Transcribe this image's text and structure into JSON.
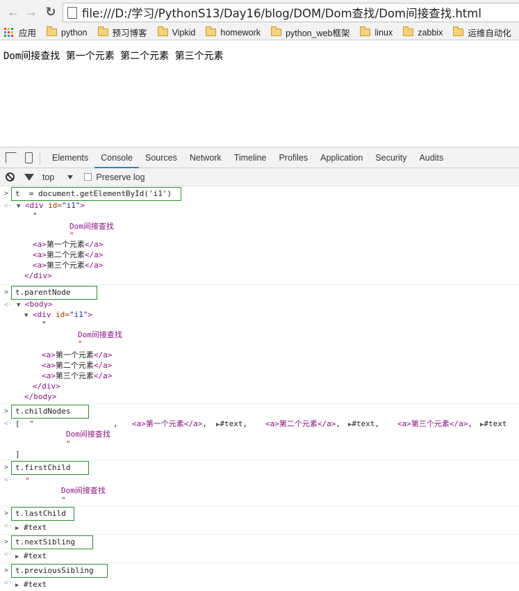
{
  "browser": {
    "url": "file:///D:/学习/PythonS13/Day16/blog/DOM/Dom查找/Dom间接查找.html",
    "bookmarks": [
      {
        "label": "应用",
        "icon": "apps-grid-icon"
      },
      {
        "label": "python",
        "icon": "folder-icon"
      },
      {
        "label": "预习博客",
        "icon": "folder-icon"
      },
      {
        "label": "Vipkid",
        "icon": "folder-icon"
      },
      {
        "label": "homework",
        "icon": "folder-icon"
      },
      {
        "label": "python_web框架",
        "icon": "folder-icon"
      },
      {
        "label": "linux",
        "icon": "folder-icon"
      },
      {
        "label": "zabbix",
        "icon": "folder-icon"
      },
      {
        "label": "运维自动化",
        "icon": "folder-icon"
      }
    ]
  },
  "page": {
    "content": "Dom间接查找 第一个元素 第二个元素 第三个元素"
  },
  "devtools": {
    "tabs": [
      "Elements",
      "Console",
      "Sources",
      "Network",
      "Timeline",
      "Profiles",
      "Application",
      "Security",
      "Audits"
    ],
    "active_tab": "Console",
    "context": "top",
    "preserve_log": "Preserve log"
  },
  "console": {
    "cmd1": "t  = document.getElementById('i1')",
    "cmd2": "t.parentNode",
    "cmd3": "t.childNodes",
    "cmd4": "t.firstChild",
    "cmd5": "t.lastChild",
    "cmd6": "t.nextSibling",
    "cmd7": "t.previousSibling",
    "div_open": "<div",
    "div_attr": " id=",
    "div_val": "\"i1\"",
    "div_close_bracket": ">",
    "quote": "\"",
    "dom_text": "Dom间接查找",
    "a_open": "<a>",
    "a_close": "</a>",
    "el1": "第一个元素",
    "el2": "第二个元素",
    "el3": "第三个元素",
    "div_end": "</div>",
    "body_open": "<body>",
    "body_end": "</body>",
    "array_open": "[",
    "array_close": "]",
    "text_node": "#text",
    "comma": ",",
    "text_after_comma": "#text,"
  },
  "colors": {
    "tag": "#881280",
    "attr": "#994500",
    "attr_value": "#1a1aa6",
    "command_box_border": "#2f8a2f",
    "active_tab_underline": "#3879d9"
  }
}
